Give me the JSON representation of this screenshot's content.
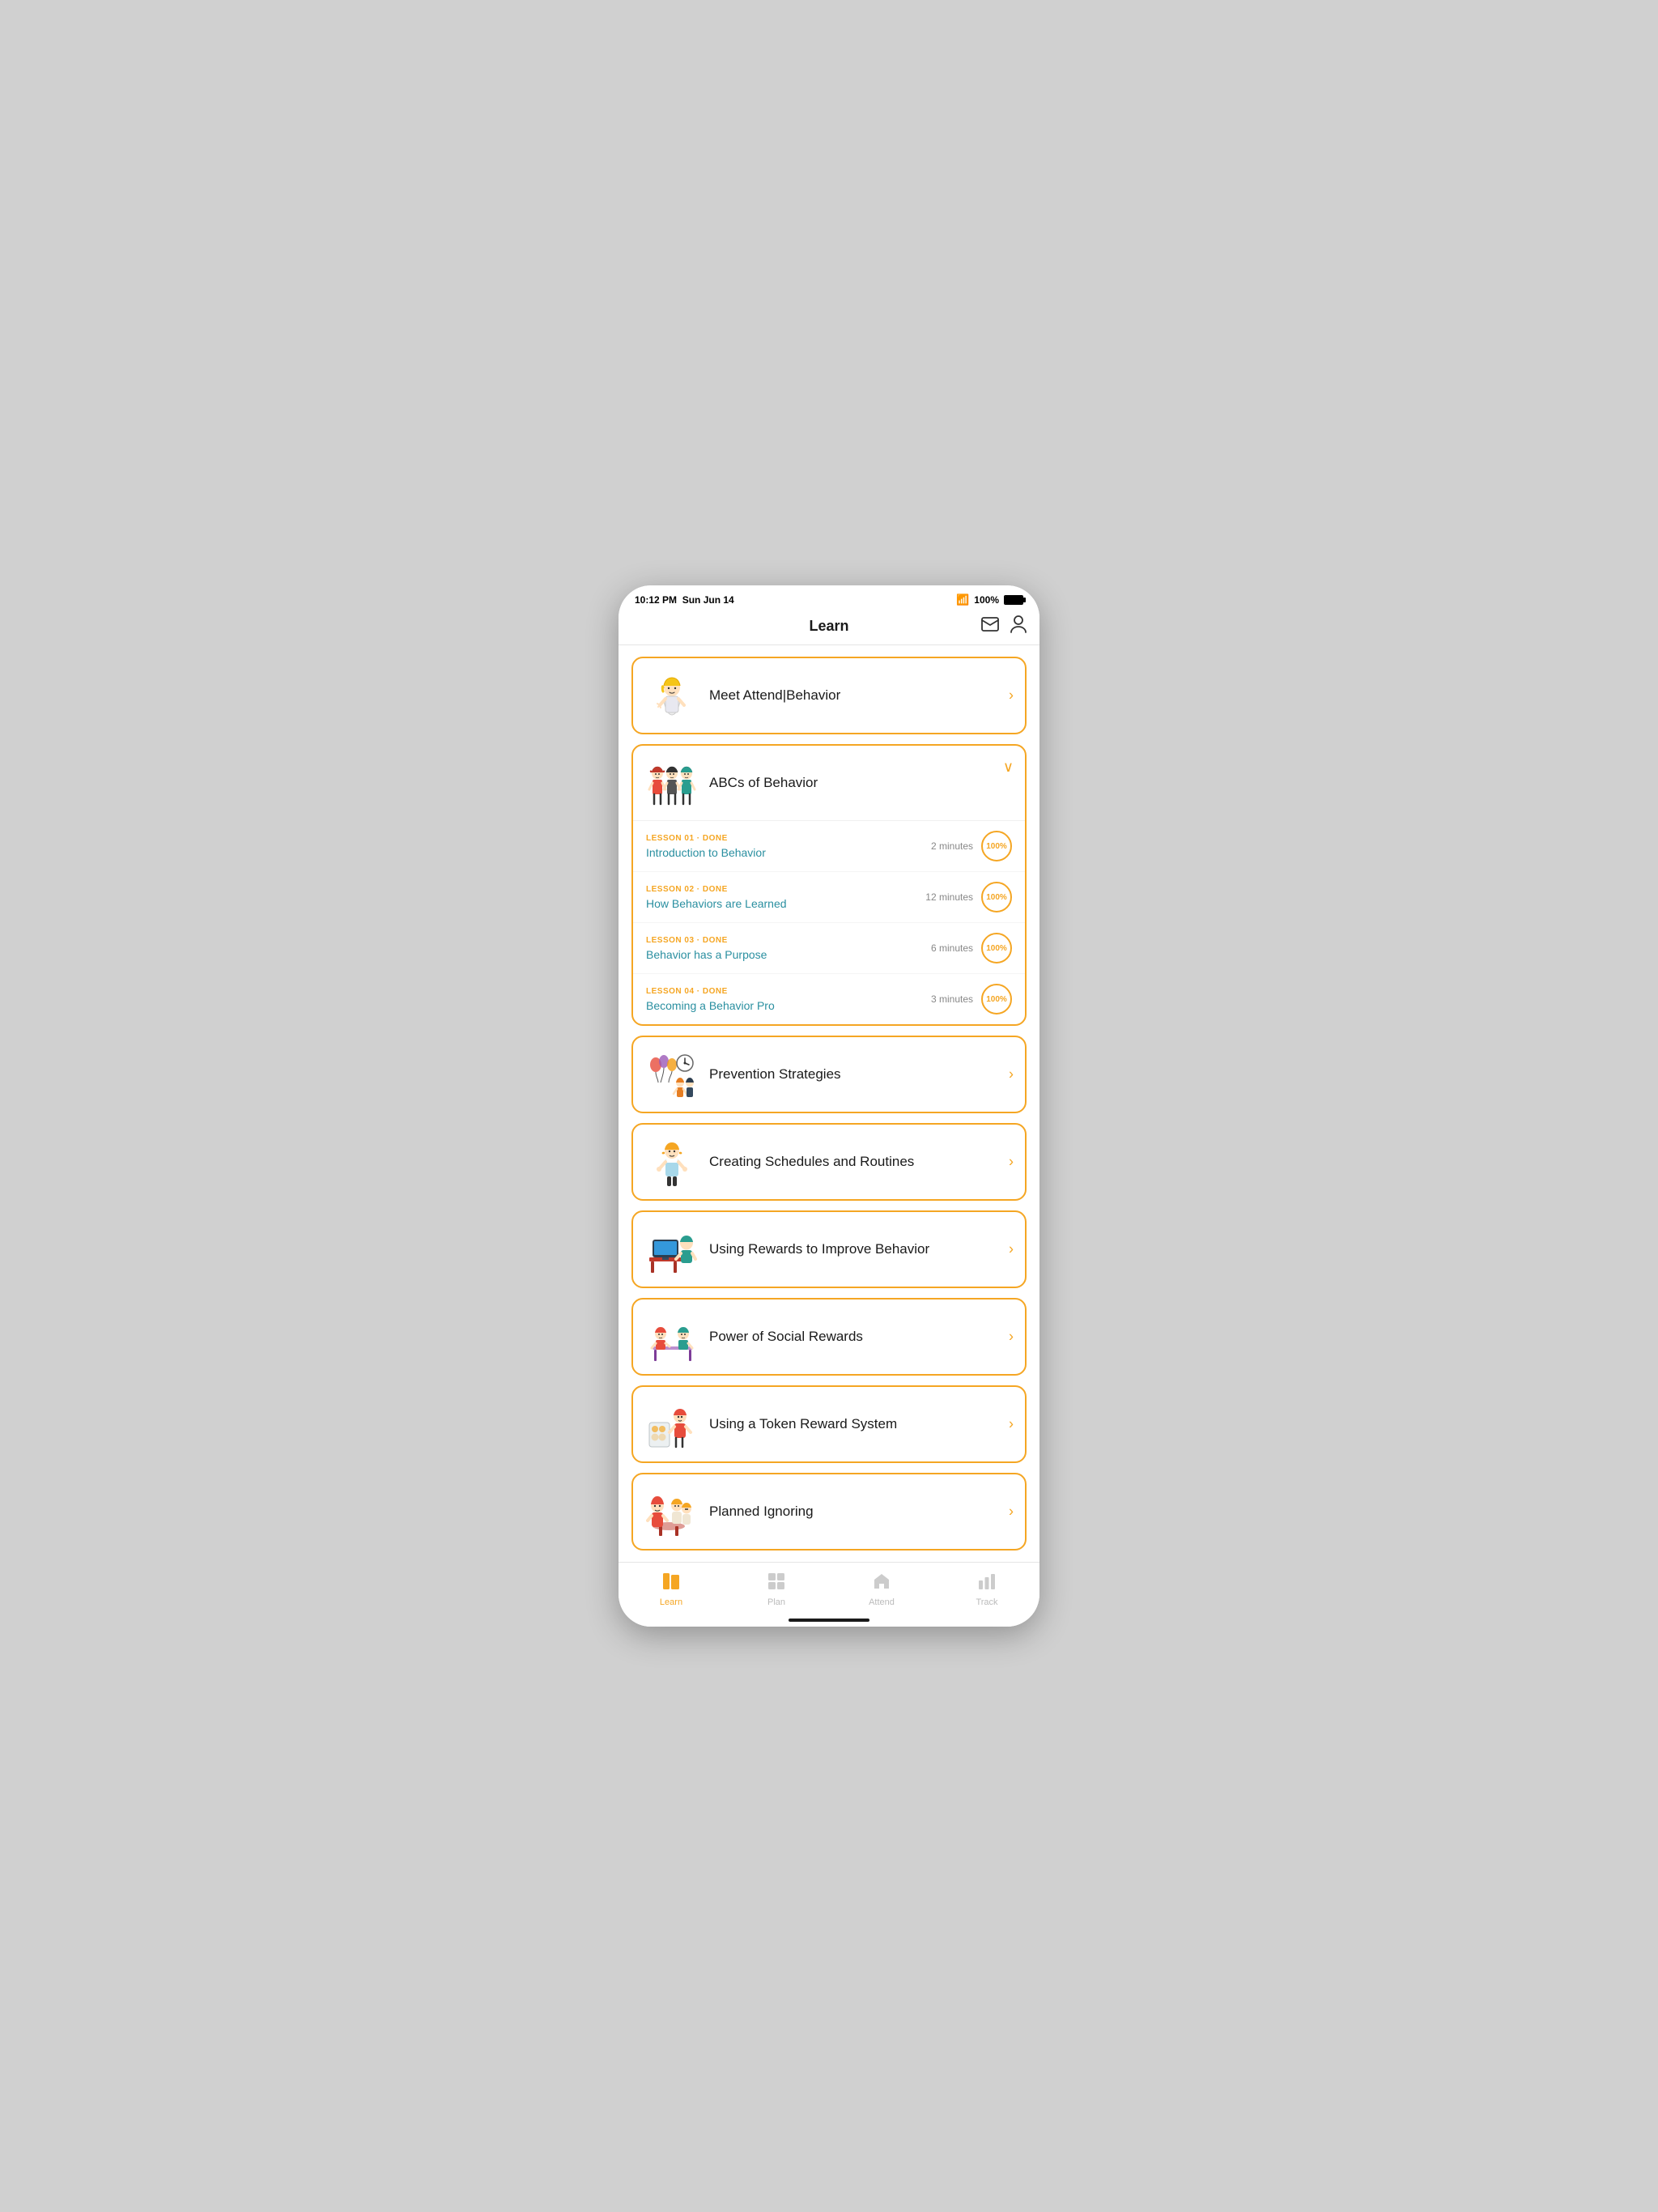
{
  "statusBar": {
    "time": "10:12 PM",
    "date": "Sun Jun 14",
    "battery": "100%"
  },
  "header": {
    "title": "Learn",
    "mailIcon": "✉",
    "profileIcon": "👤"
  },
  "cards": [
    {
      "id": "meet",
      "title": "Meet Attend|Behavior",
      "expanded": false,
      "chevron": "›"
    },
    {
      "id": "abcs",
      "title": "ABCs of Behavior",
      "expanded": true,
      "chevron": "∨",
      "lessons": [
        {
          "meta": "LESSON 01 · DONE",
          "title": "Introduction to Behavior",
          "duration": "2 minutes",
          "progress": "100%"
        },
        {
          "meta": "LESSON 02 · DONE",
          "title": "How Behaviors are Learned",
          "duration": "12 minutes",
          "progress": "100%"
        },
        {
          "meta": "LESSON 03 · DONE",
          "title": "Behavior has a Purpose",
          "duration": "6 minutes",
          "progress": "100%"
        },
        {
          "meta": "LESSON 04 · DONE",
          "title": "Becoming a Behavior Pro",
          "duration": "3 minutes",
          "progress": "100%"
        }
      ]
    },
    {
      "id": "prevention",
      "title": "Prevention Strategies",
      "expanded": false,
      "chevron": "›"
    },
    {
      "id": "schedules",
      "title": "Creating Schedules and Routines",
      "expanded": false,
      "chevron": "›"
    },
    {
      "id": "rewards",
      "title": "Using Rewards to Improve Behavior",
      "expanded": false,
      "chevron": "›"
    },
    {
      "id": "social",
      "title": "Power of Social Rewards",
      "expanded": false,
      "chevron": "›"
    },
    {
      "id": "token",
      "title": "Using a Token Reward System",
      "expanded": false,
      "chevron": "›"
    },
    {
      "id": "ignoring",
      "title": "Planned Ignoring",
      "expanded": false,
      "chevron": "›"
    }
  ],
  "bottomNav": [
    {
      "id": "learn",
      "label": "Learn",
      "active": true,
      "icon": "book"
    },
    {
      "id": "plan",
      "label": "Plan",
      "active": false,
      "icon": "grid"
    },
    {
      "id": "attend",
      "label": "Attend",
      "active": false,
      "icon": "home"
    },
    {
      "id": "track",
      "label": "Track",
      "active": false,
      "icon": "bars"
    }
  ]
}
